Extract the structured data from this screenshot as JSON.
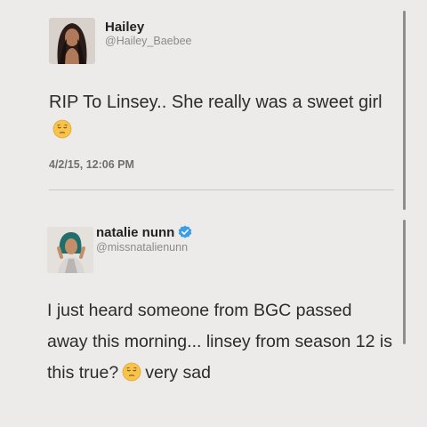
{
  "tweets": [
    {
      "name": "Hailey",
      "handle": "@Hailey_Baebee",
      "text_before_emoji": "RIP To Linsey.. She really was a sweet girl",
      "emoji_icon": "pensive-face-icon",
      "timestamp": "4/2/15, 12:06 PM",
      "verified": false
    },
    {
      "name": "natalie nunn",
      "handle": "@missnatalienunn",
      "text_before_emoji": "I just heard someone from BGC passed away this morning... linsey from season 12 is this true?",
      "emoji_icon": "pensive-face-icon",
      "text_after_emoji": "very sad",
      "verified": true
    }
  ],
  "colors": {
    "background": "#ecebe9",
    "verified_blue": "#3a9de6",
    "emoji_yellow": "#f7c34a"
  }
}
